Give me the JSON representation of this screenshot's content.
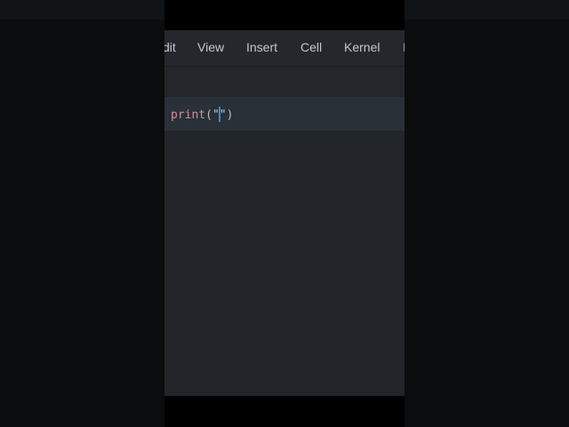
{
  "menu": {
    "items": [
      "dit",
      "View",
      "Insert",
      "Cell",
      "Kernel",
      "I"
    ]
  },
  "cell": {
    "keyword": "print",
    "open_paren": "(",
    "open_quote": "\"",
    "close_quote": "\"",
    "close_paren": ")"
  },
  "colors": {
    "keyword": "#d88e9f",
    "cursor": "#2f8fe0",
    "background": "#22252a"
  }
}
